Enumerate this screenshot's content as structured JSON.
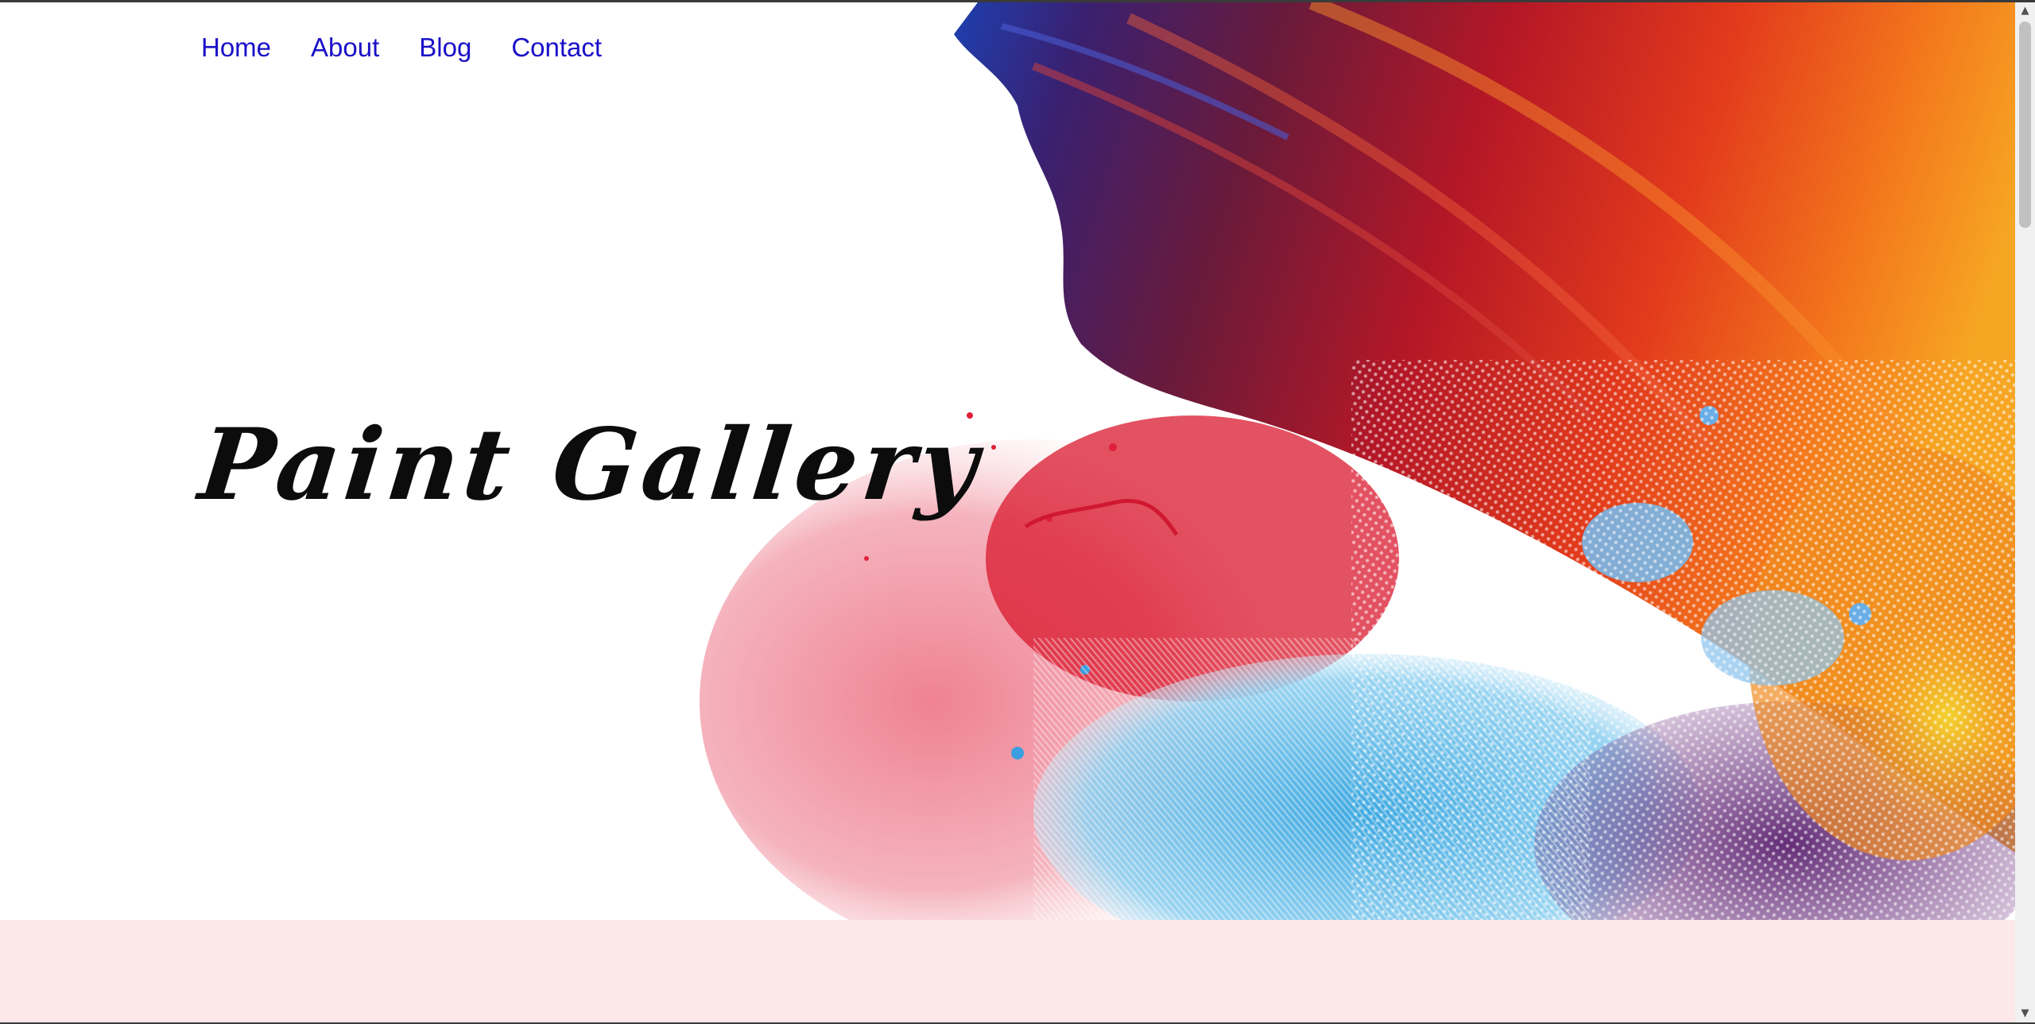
{
  "nav": {
    "items": [
      {
        "label": "Home"
      },
      {
        "label": "About"
      },
      {
        "label": "Blog"
      },
      {
        "label": "Contact"
      }
    ],
    "link_color": "#1a10c8"
  },
  "hero": {
    "title": "Paint Gallery",
    "image_icon": "paint-splash-artwork"
  },
  "band": {
    "color": "#fce8e9"
  },
  "scrollbar": {
    "up_icon": "▲",
    "down_icon": "▼"
  }
}
